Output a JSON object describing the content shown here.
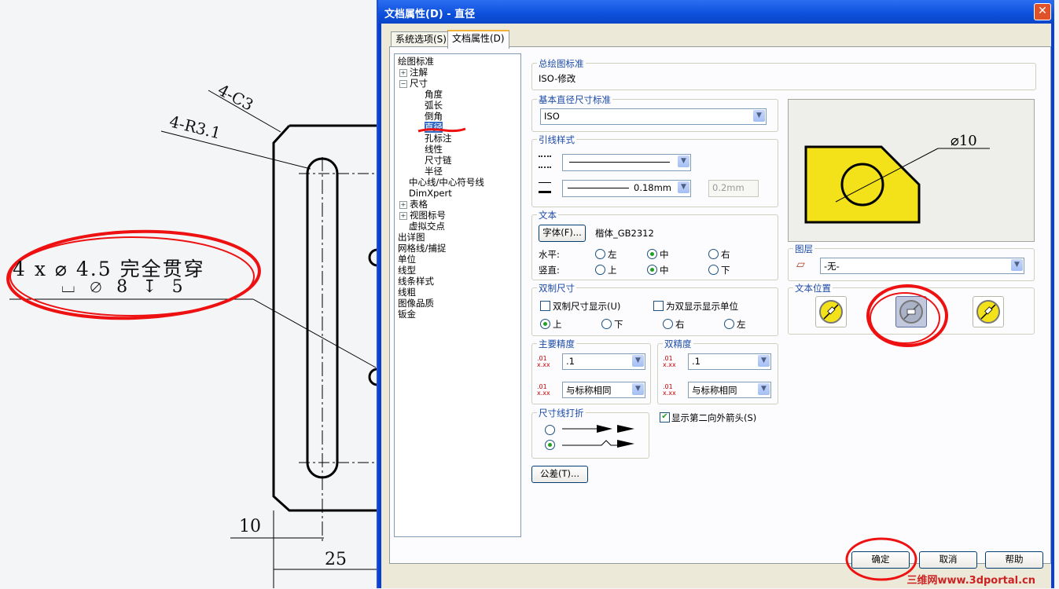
{
  "cad": {
    "dim_4c3": "4-C3",
    "dim_r31": "4-R3.1",
    "hole_line1": "4 x ⌀ 4.5 完全贯穿",
    "hole_line2": "⌴ ⌀ 8 ↧ 5",
    "dim_10": "10",
    "dim_25": "25"
  },
  "dialog": {
    "title": "文档属性(D) - 直径",
    "close": "✕",
    "tabs": [
      {
        "label": "系统选项(S)",
        "active": false
      },
      {
        "label": "文档属性(D)",
        "active": true
      }
    ],
    "tree": [
      {
        "label": "绘图标准",
        "level": 0,
        "toggle": ""
      },
      {
        "label": "注解",
        "level": 0,
        "toggle": "+"
      },
      {
        "label": "尺寸",
        "level": 0,
        "toggle": "−"
      },
      {
        "label": "角度",
        "level": 2,
        "toggle": ""
      },
      {
        "label": "弧长",
        "level": 2,
        "toggle": ""
      },
      {
        "label": "倒角",
        "level": 2,
        "toggle": ""
      },
      {
        "label": "直径",
        "level": 2,
        "toggle": "",
        "selected": true
      },
      {
        "label": "孔标注",
        "level": 2,
        "toggle": ""
      },
      {
        "label": "线性",
        "level": 2,
        "toggle": ""
      },
      {
        "label": "尺寸链",
        "level": 2,
        "toggle": ""
      },
      {
        "label": "半径",
        "level": 2,
        "toggle": ""
      },
      {
        "label": "中心线/中心符号线",
        "level": 1,
        "toggle": ""
      },
      {
        "label": "DimXpert",
        "level": 1,
        "toggle": ""
      },
      {
        "label": "表格",
        "level": 0,
        "toggle": "+"
      },
      {
        "label": "视图标号",
        "level": 0,
        "toggle": "+"
      },
      {
        "label": "虚拟交点",
        "level": 1,
        "toggle": ""
      },
      {
        "label": "出详图",
        "level": 0,
        "toggle": ""
      },
      {
        "label": "网格线/捕捉",
        "level": 0,
        "toggle": ""
      },
      {
        "label": "单位",
        "level": 0,
        "toggle": ""
      },
      {
        "label": "线型",
        "level": 0,
        "toggle": ""
      },
      {
        "label": "线条样式",
        "level": 0,
        "toggle": ""
      },
      {
        "label": "线粗",
        "level": 0,
        "toggle": ""
      },
      {
        "label": "图像品质",
        "level": 0,
        "toggle": ""
      },
      {
        "label": "钣金",
        "level": 0,
        "toggle": ""
      }
    ],
    "overall_standard": {
      "title": "总绘图标准",
      "value": "ISO-修改"
    },
    "base_standard": {
      "title": "基本直径尺寸标准",
      "value": "ISO"
    },
    "leader_style": {
      "title": "引线样式",
      "thickness_value": "0.18mm",
      "custom_value": "0.2mm"
    },
    "text": {
      "title": "文本",
      "font_button": "字体(F)...",
      "font_name": "楷体_GB2312",
      "horizontal_label": "水平:",
      "horizontal_options": [
        "左",
        "中",
        "右"
      ],
      "horizontal_selected": 1,
      "vertical_label": "竖直:",
      "vertical_options": [
        "上",
        "中",
        "下"
      ],
      "vertical_selected": 1
    },
    "dual": {
      "title": "双制尺寸",
      "show_label": "双制尺寸显示(U)",
      "show_checked": false,
      "units_label": "为双显示显示单位",
      "units_checked": false,
      "positions": [
        "上",
        "下",
        "右",
        "左"
      ],
      "selected": 0
    },
    "primary_precision": {
      "title": "主要精度",
      "value1": ".1",
      "value2": "与标称相同",
      "icon1": "xxx-precision-icon",
      "icon2": "tolerance-precision-icon"
    },
    "dual_precision": {
      "title": "双精度",
      "value1": ".1",
      "value2": "与标称相同"
    },
    "break": {
      "title": "尺寸线打折",
      "selected": 1
    },
    "show_second_arrow": {
      "label": "显示第二向外箭头(S)",
      "checked": true
    },
    "tolerance_button": "公差(T)...",
    "preview": {
      "dim_text": "⌀10",
      "fill": "#f3e21a"
    },
    "layer": {
      "title": "图层",
      "value": "-无-"
    },
    "text_position": {
      "title": "文本位置",
      "selected": 1
    },
    "buttons": {
      "ok": "确定",
      "cancel": "取消",
      "help": "帮助"
    },
    "watermark": "三维网www.3dportal.cn"
  }
}
